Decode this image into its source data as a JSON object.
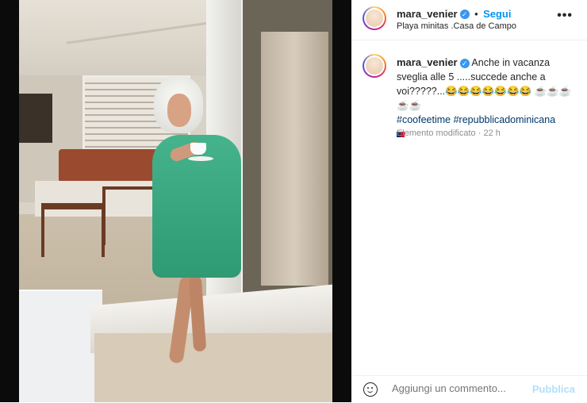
{
  "post": {
    "username": "mara_venier",
    "verified_badge": "✓",
    "separator": "•",
    "follow_label": "Segui",
    "location": "Playa minitas .Casa de Campo",
    "more_icon": "•••"
  },
  "caption": {
    "username": "mara_venier",
    "verified_badge": "✓",
    "text": "Anche in vacanza sveglia alle 5 .....succede anche a voi?????...😂😂😂😂😂😂😂 ☕☕☕☕☕",
    "hashtag1": "#coofeetime",
    "hashtag2": "#repubblicadominicana",
    "edited": "Elemento modificato",
    "time_separator": "·",
    "time": "22 h"
  },
  "comment": {
    "placeholder": "Aggiungi un commento...",
    "publish_label": "Pubblica"
  },
  "colors": {
    "follow": "#0095f6",
    "verified": "#3897f0",
    "hashtag": "#00376b",
    "publish_disabled": "#b2dffc",
    "muted": "#8e8e8e",
    "dress": "#3aa882"
  },
  "icons": {
    "emoji": "emoji-smiley-icon",
    "more": "more-options-icon",
    "verified": "verified-badge-icon",
    "flag": "flag-dominican-republic-icon"
  }
}
